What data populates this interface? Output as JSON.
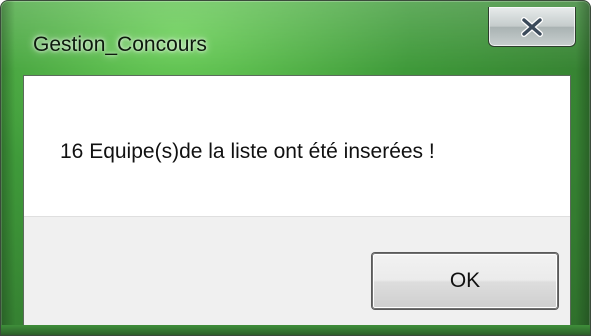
{
  "window": {
    "title": "Gestion_Concours",
    "close_icon": "close-icon"
  },
  "message": {
    "text": "16 Equipe(s)de la liste ont été inserées !"
  },
  "buttons": {
    "ok_label": "OK"
  },
  "colors": {
    "frame_green": "#3f9a3a",
    "content_bg": "#ffffff",
    "button_area_bg": "#f0f0f0"
  }
}
